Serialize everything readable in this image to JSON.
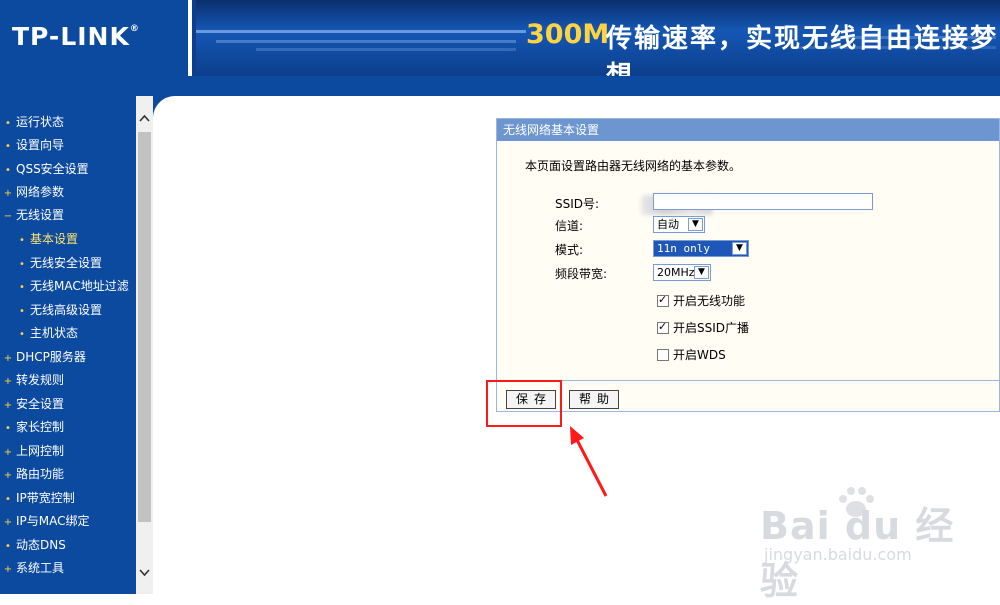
{
  "header": {
    "logo": "TP-LINK",
    "slogan_number": "300M",
    "slogan_text": "传输速率，实现无线自由连接梦想"
  },
  "sidebar": {
    "items": [
      {
        "label": "运行状态",
        "bullet": "•"
      },
      {
        "label": "设置向导",
        "bullet": "•"
      },
      {
        "label": "QSS安全设置",
        "bullet": "•"
      },
      {
        "label": "网络参数",
        "bullet": "+"
      },
      {
        "label": "无线设置",
        "bullet": "−"
      },
      {
        "label": "基本设置",
        "bullet": "•"
      },
      {
        "label": "无线安全设置",
        "bullet": "•"
      },
      {
        "label": "无线MAC地址过滤",
        "bullet": "•"
      },
      {
        "label": "无线高级设置",
        "bullet": "•"
      },
      {
        "label": "主机状态",
        "bullet": "•"
      },
      {
        "label": "DHCP服务器",
        "bullet": "+"
      },
      {
        "label": "转发规则",
        "bullet": "+"
      },
      {
        "label": "安全设置",
        "bullet": "+"
      },
      {
        "label": "家长控制",
        "bullet": "•"
      },
      {
        "label": "上网控制",
        "bullet": "+"
      },
      {
        "label": "路由功能",
        "bullet": "+"
      },
      {
        "label": "IP带宽控制",
        "bullet": "•"
      },
      {
        "label": "IP与MAC绑定",
        "bullet": "+"
      },
      {
        "label": "动态DNS",
        "bullet": "•"
      },
      {
        "label": "系统工具",
        "bullet": "+"
      }
    ]
  },
  "scrollbar": {
    "up": "⌃",
    "down": "⌄"
  },
  "panel": {
    "title": "无线网络基本设置",
    "description": "本页面设置路由器无线网络的基本参数。",
    "ssid_label": "SSID号:",
    "ssid_value": "",
    "channel_label": "信道:",
    "channel_value": "自动",
    "mode_label": "模式:",
    "mode_value": "11n only",
    "bandwidth_label": "频段带宽:",
    "bandwidth_value": "20MHz",
    "checkboxes": [
      {
        "label": "开启无线功能",
        "checked": true
      },
      {
        "label": "开启SSID广播",
        "checked": true
      },
      {
        "label": "开启WDS",
        "checked": false
      }
    ],
    "save_label": "保存",
    "help_label": "帮助"
  },
  "watermark": {
    "main": "Bai du 经验",
    "sub": "jingyan.baidu.com"
  },
  "colors": {
    "nav_blue": "#0c4aa0",
    "panel_title": "#6d96d1",
    "highlight": "#ff1a1a"
  }
}
